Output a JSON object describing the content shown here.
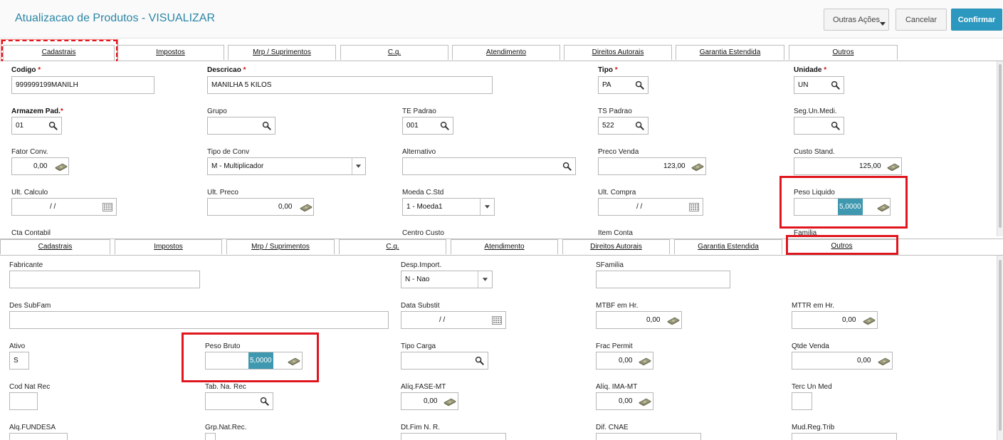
{
  "header": {
    "title": "Atualizacao de Produtos - VISUALIZAR",
    "buttons": {
      "more": "Outras Ações",
      "cancel": "Cancelar",
      "confirm": "Confirmar"
    }
  },
  "tabs": [
    "Cadastrais",
    "Impostos",
    "Mrp / Suprimentos",
    "C.q.",
    "Atendimento",
    "Direitos Autorais",
    "Garantia Estendida",
    "Outros"
  ],
  "top": {
    "fields": {
      "codigo": {
        "label": "Codigo",
        "value": "999999199MANILH"
      },
      "descricao": {
        "label": "Descricao",
        "value": "MANILHA 5 KILOS"
      },
      "tipo": {
        "label": "Tipo",
        "value": "PA"
      },
      "unidade": {
        "label": "Unidade",
        "value": "UN"
      },
      "armazem": {
        "label": "Armazem Pad.",
        "value": "01"
      },
      "grupo": {
        "label": "Grupo",
        "value": ""
      },
      "te_padrao": {
        "label": "TE Padrao",
        "value": "001"
      },
      "ts_padrao": {
        "label": "TS Padrao",
        "value": "522"
      },
      "seg_un_medi": {
        "label": "Seg.Un.Medi.",
        "value": ""
      },
      "fator_conv": {
        "label": "Fator Conv.",
        "value": "0,00"
      },
      "tipo_conv": {
        "label": "Tipo de Conv",
        "value": "M - Multiplicador"
      },
      "alternativo": {
        "label": "Alternativo",
        "value": ""
      },
      "preco_venda": {
        "label": "Preco Venda",
        "value": "123,00"
      },
      "custo_stand": {
        "label": "Custo Stand.",
        "value": "125,00"
      },
      "ult_calculo": {
        "label": "Ult. Calculo",
        "value": "/ /"
      },
      "ult_preco": {
        "label": "Ult. Preco",
        "value": "0,00"
      },
      "moeda_cstd": {
        "label": "Moeda C.Std",
        "value": "1 - Moeda1"
      },
      "ult_compra": {
        "label": "Ult. Compra",
        "value": "/ /"
      },
      "peso_liquido": {
        "label": "Peso Liquido",
        "value": "5,0000"
      },
      "cta_contabil": {
        "label": "Cta Contabil"
      },
      "centro_custo": {
        "label": "Centro Custo"
      },
      "item_conta": {
        "label": "Item Conta"
      },
      "familia": {
        "label": "Familia"
      }
    }
  },
  "bottom": {
    "fields": {
      "fabricante": {
        "label": "Fabricante",
        "value": ""
      },
      "desp_import": {
        "label": "Desp.Import.",
        "value": "N - Nao"
      },
      "sfamilia": {
        "label": "SFamilia",
        "value": ""
      },
      "des_subfam": {
        "label": "Des SubFam",
        "value": ""
      },
      "data_substit": {
        "label": "Data Substit",
        "value": "/ /"
      },
      "mtbf": {
        "label": "MTBF em Hr.",
        "value": "0,00"
      },
      "mttr": {
        "label": "MTTR em Hr.",
        "value": "0,00"
      },
      "ativo": {
        "label": "Ativo",
        "value": "S"
      },
      "peso_bruto": {
        "label": "Peso Bruto",
        "value": "5,0000"
      },
      "tipo_carga": {
        "label": "Tipo Carga",
        "value": ""
      },
      "frac_permit": {
        "label": "Frac Permit",
        "value": "0,00"
      },
      "qtde_venda": {
        "label": "Qtde Venda",
        "value": "0,00"
      },
      "cod_nat_rec": {
        "label": "Cod Nat Rec",
        "value": ""
      },
      "tab_na_rec": {
        "label": "Tab. Na. Rec",
        "value": ""
      },
      "aliq_fase_mt": {
        "label": "Alíq.FASE-MT",
        "value": "0,00"
      },
      "aliq_ima_mt": {
        "label": "Alíq. IMA-MT",
        "value": "0,00"
      },
      "terc_un_med": {
        "label": "Terc Un Med",
        "value": ""
      },
      "aliq_fundesa": {
        "label": "Alq.FUNDESA"
      },
      "grp_nat_rec": {
        "label": "Grp.Nat.Rec."
      },
      "dt_fim_nr": {
        "label": "Dt.Fim N. R."
      },
      "dif_cnae": {
        "label": "Dif. CNAE"
      },
      "mud_reg_trib": {
        "label": "Mud.Reg.Trib"
      }
    }
  },
  "icons": {
    "search": "magnifier-icon",
    "money": "banknote-icon",
    "calendar": "calendar-icon",
    "dropdown": "chevron-down-icon"
  },
  "colors": {
    "title": "#2a86a6",
    "confirm": "#2c98bf",
    "highlight_border": "#e0161f",
    "selected_value": "#3d98b0",
    "required": "#d01010"
  }
}
